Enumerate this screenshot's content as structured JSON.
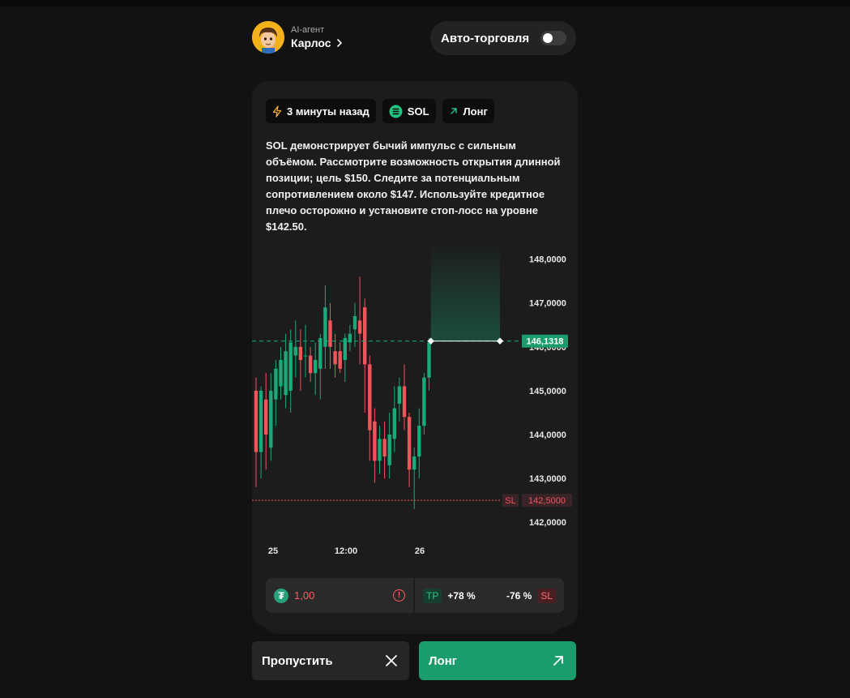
{
  "agent": {
    "label": "AI-агент",
    "name": "Карлос",
    "avatar_icon": "cartoon-avatar"
  },
  "auto_trade": {
    "label": "Авто-торговля",
    "enabled": false
  },
  "signal": {
    "time_chip": "3 минуты назад",
    "asset_chip": "SOL",
    "direction_chip": "Лонг",
    "description": "SOL демонстрирует бычий импульс с сильным объёмом. Рассмотрите возможность открытия длинной позиции; цель $150. Следите за потенциальным сопротивлением около $147. Используйте кредитное плечо осторожно и установите стоп-лосс на уровне $142.50."
  },
  "chart_data": {
    "type": "candlestick",
    "y_ticks": [
      "148,0000",
      "147,0000",
      "146,0000",
      "145,0000",
      "144,0000",
      "143,0000",
      "142,0000"
    ],
    "ylim": [
      141.8,
      148.4
    ],
    "x_ticks": [
      "25",
      "12:00",
      "26"
    ],
    "entry_price": 146.1318,
    "entry_label": "146,1318",
    "stop_loss": 142.5,
    "stop_loss_label": "142,5000",
    "stop_loss_tag": "SL",
    "candles": [
      {
        "o": 145.0,
        "h": 145.3,
        "l": 142.8,
        "c": 143.6
      },
      {
        "o": 143.6,
        "h": 145.1,
        "l": 143.0,
        "c": 145.0
      },
      {
        "o": 144.8,
        "h": 145.4,
        "l": 143.2,
        "c": 144.0
      },
      {
        "o": 143.7,
        "h": 145.4,
        "l": 143.4,
        "c": 145.0
      },
      {
        "o": 144.8,
        "h": 145.7,
        "l": 144.2,
        "c": 145.5
      },
      {
        "o": 145.1,
        "h": 146.0,
        "l": 144.8,
        "c": 145.7
      },
      {
        "o": 144.9,
        "h": 146.3,
        "l": 144.6,
        "c": 145.9
      },
      {
        "o": 145.0,
        "h": 146.4,
        "l": 144.5,
        "c": 146.1
      },
      {
        "o": 145.8,
        "h": 146.6,
        "l": 145.3,
        "c": 146.0
      },
      {
        "o": 146.0,
        "h": 146.4,
        "l": 145.0,
        "c": 145.7
      },
      {
        "o": 145.8,
        "h": 146.5,
        "l": 145.3,
        "c": 145.8
      },
      {
        "o": 145.8,
        "h": 146.0,
        "l": 145.2,
        "c": 145.4
      },
      {
        "o": 145.4,
        "h": 146.1,
        "l": 144.9,
        "c": 145.7
      },
      {
        "o": 145.5,
        "h": 146.3,
        "l": 144.8,
        "c": 146.2
      },
      {
        "o": 146.0,
        "h": 147.4,
        "l": 145.5,
        "c": 146.9
      },
      {
        "o": 146.6,
        "h": 147.0,
        "l": 145.5,
        "c": 146.0
      },
      {
        "o": 145.9,
        "h": 146.3,
        "l": 145.3,
        "c": 145.6
      },
      {
        "o": 145.9,
        "h": 146.1,
        "l": 145.4,
        "c": 145.5
      },
      {
        "o": 145.7,
        "h": 146.3,
        "l": 145.2,
        "c": 146.2
      },
      {
        "o": 146.1,
        "h": 146.5,
        "l": 145.9,
        "c": 146.3
      },
      {
        "o": 146.4,
        "h": 147.0,
        "l": 146.0,
        "c": 146.7
      },
      {
        "o": 146.6,
        "h": 147.6,
        "l": 145.6,
        "c": 146.3
      },
      {
        "o": 146.9,
        "h": 147.1,
        "l": 144.5,
        "c": 145.6
      },
      {
        "o": 145.6,
        "h": 145.8,
        "l": 143.4,
        "c": 144.1
      },
      {
        "o": 144.3,
        "h": 144.6,
        "l": 142.9,
        "c": 143.4
      },
      {
        "o": 143.4,
        "h": 144.2,
        "l": 143.1,
        "c": 143.9
      },
      {
        "o": 143.9,
        "h": 144.3,
        "l": 143.0,
        "c": 143.5
      },
      {
        "o": 143.3,
        "h": 144.5,
        "l": 143.0,
        "c": 144.0
      },
      {
        "o": 143.9,
        "h": 145.1,
        "l": 143.6,
        "c": 144.6
      },
      {
        "o": 144.7,
        "h": 145.3,
        "l": 144.3,
        "c": 145.1
      },
      {
        "o": 145.1,
        "h": 145.6,
        "l": 144.1,
        "c": 144.4
      },
      {
        "o": 144.4,
        "h": 144.5,
        "l": 142.8,
        "c": 143.2
      },
      {
        "o": 143.2,
        "h": 143.7,
        "l": 142.3,
        "c": 143.5
      },
      {
        "o": 143.5,
        "h": 144.6,
        "l": 143.0,
        "c": 144.2
      },
      {
        "o": 144.2,
        "h": 145.4,
        "l": 144.0,
        "c": 145.3
      },
      {
        "o": 145.3,
        "h": 146.2,
        "l": 145.0,
        "c": 146.1
      }
    ]
  },
  "position": {
    "currency_icon": "tether-icon",
    "amount": "1,00",
    "tp_tag": "TP",
    "tp_value": "+78 %",
    "sl_value": "-76 %",
    "sl_tag": "SL"
  },
  "actions": {
    "skip_label": "Пропустить",
    "long_label": "Лонг"
  },
  "colors": {
    "up": "#1aa978",
    "down": "#f0555c",
    "accent": "#1b9c6c"
  }
}
